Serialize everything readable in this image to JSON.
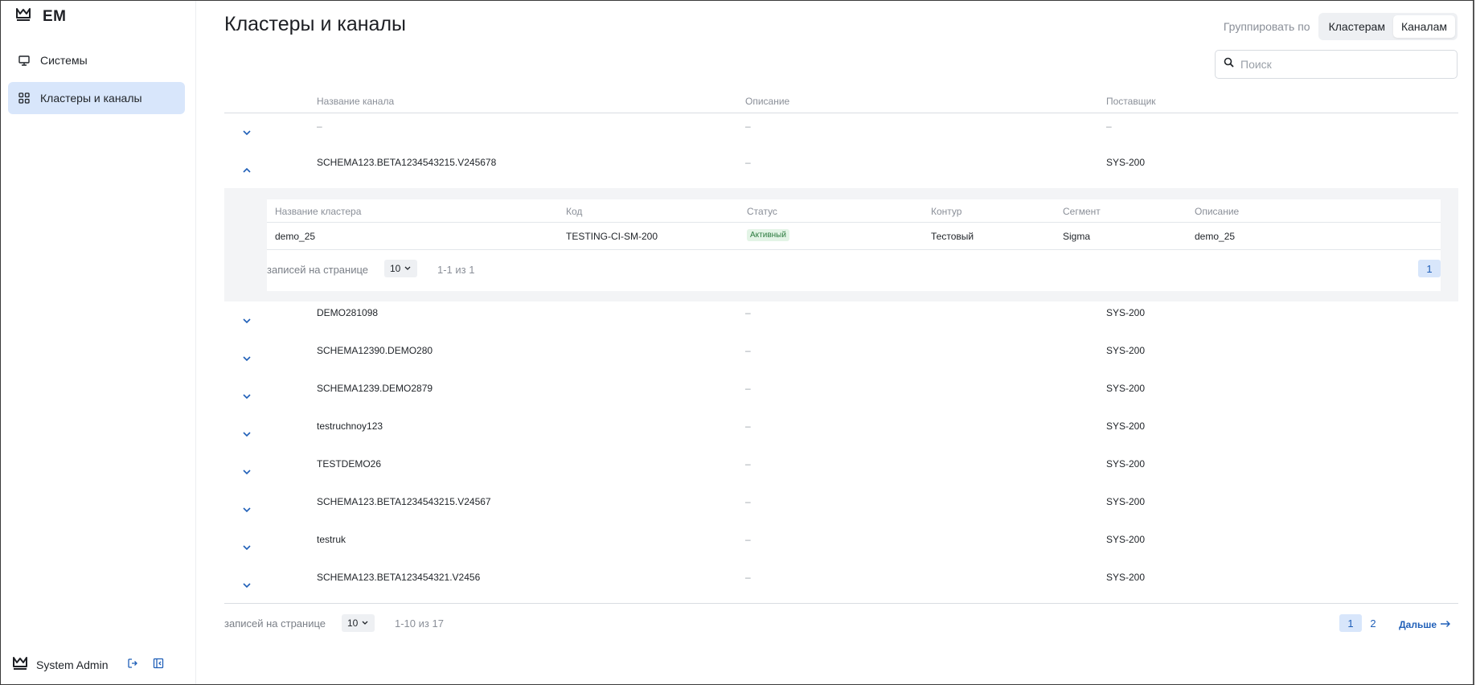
{
  "app": {
    "logo_text": "EM"
  },
  "sidebar": {
    "items": [
      {
        "label": "Системы",
        "icon": "monitor-icon"
      },
      {
        "label": "Кластеры и каналы",
        "icon": "grid-icon"
      }
    ],
    "user": {
      "name": "System Admin"
    }
  },
  "header": {
    "title": "Кластеры и каналы",
    "group_by_label": "Группировать по",
    "group_options": [
      "Кластерам",
      "Каналам"
    ],
    "group_selected": "Каналам",
    "search_placeholder": "Поиск"
  },
  "table": {
    "columns": [
      "Название канала",
      "Описание",
      "Поставщик"
    ],
    "rows": [
      {
        "name": "–",
        "description": "–",
        "provider": "–",
        "expanded": false
      },
      {
        "name": "SCHEMA123.BETA1234543215.V245678",
        "description": "–",
        "provider": "SYS-200",
        "expanded": true
      },
      {
        "name": "DEMO281098",
        "description": "–",
        "provider": "SYS-200",
        "expanded": false
      },
      {
        "name": "SCHEMA12390.DEMO280",
        "description": "–",
        "provider": "SYS-200",
        "expanded": false
      },
      {
        "name": "SCHEMA1239.DEMO2879",
        "description": "–",
        "provider": "SYS-200",
        "expanded": false
      },
      {
        "name": "testruchnoy123",
        "description": "–",
        "provider": "SYS-200",
        "expanded": false
      },
      {
        "name": "TESTDEMO26",
        "description": "–",
        "provider": "SYS-200",
        "expanded": false
      },
      {
        "name": "SCHEMA123.BETA1234543215.V24567",
        "description": "–",
        "provider": "SYS-200",
        "expanded": false
      },
      {
        "name": "testruk",
        "description": "–",
        "provider": "SYS-200",
        "expanded": false
      },
      {
        "name": "SCHEMA123.BETA123454321.V2456",
        "description": "–",
        "provider": "SYS-200",
        "expanded": false
      }
    ]
  },
  "subtable": {
    "columns": [
      "Название кластера",
      "Код",
      "Статус",
      "Контур",
      "Сегмент",
      "Описание"
    ],
    "rows": [
      {
        "name": "demo_25",
        "code": "TESTING-CI-SM-200",
        "status": "Активный",
        "contour": "Тестовый",
        "segment": "Sigma",
        "description": "demo_25"
      }
    ],
    "pagination": {
      "per_page_label": "записей на странице",
      "per_page": "10",
      "range": "1-1 из 1",
      "page": "1"
    }
  },
  "pagination": {
    "per_page_label": "записей на странице",
    "per_page": "10",
    "range": "1-10 из 17",
    "pages": [
      "1",
      "2"
    ],
    "current": "1",
    "next_label": "Дальше"
  },
  "colors": {
    "accent": "#1f5fb8",
    "active_bg": "#d8e6fb",
    "badge_bg": "#e3f4e6",
    "badge_text": "#2b7a3e"
  }
}
